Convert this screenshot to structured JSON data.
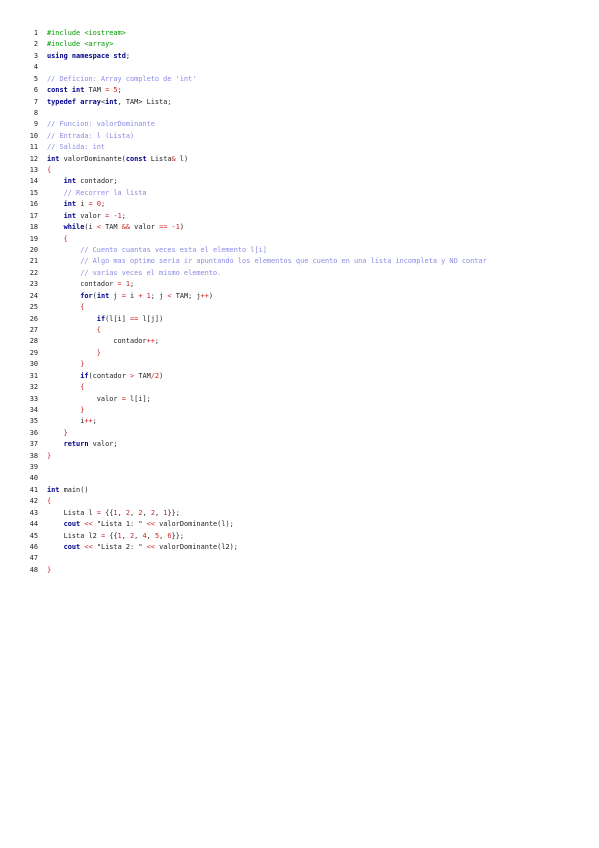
{
  "document": {
    "language": "cpp",
    "lines": [
      [
        {
          "t": "#include <iostream>",
          "c": "pp"
        }
      ],
      [
        {
          "t": "#include <array>",
          "c": "pp"
        }
      ],
      [
        {
          "t": "using",
          "c": "kw"
        },
        {
          "t": " "
        },
        {
          "t": "namespace",
          "c": "kw"
        },
        {
          "t": " "
        },
        {
          "t": "std",
          "c": "kw"
        },
        {
          "t": ";"
        }
      ],
      [],
      [
        {
          "t": "// Deficion: Array completo de 'int'",
          "c": "cm"
        }
      ],
      [
        {
          "t": "const",
          "c": "kw"
        },
        {
          "t": " "
        },
        {
          "t": "int",
          "c": "ty"
        },
        {
          "t": " TAM "
        },
        {
          "t": "=",
          "c": "op"
        },
        {
          "t": " "
        },
        {
          "t": "5",
          "c": "num"
        },
        {
          "t": ";"
        }
      ],
      [
        {
          "t": "typedef",
          "c": "kw"
        },
        {
          "t": " "
        },
        {
          "t": "array",
          "c": "kw"
        },
        {
          "t": "<"
        },
        {
          "t": "int",
          "c": "ty"
        },
        {
          "t": ", TAM> Lista;"
        }
      ],
      [],
      [
        {
          "t": "// Funcion: valorDominante",
          "c": "cm"
        }
      ],
      [
        {
          "t": "// Entrada: l (Lista)",
          "c": "cm"
        }
      ],
      [
        {
          "t": "// Salida: int",
          "c": "cm"
        }
      ],
      [
        {
          "t": "int",
          "c": "ty"
        },
        {
          "t": " valorDominante("
        },
        {
          "t": "const",
          "c": "kw"
        },
        {
          "t": " Lista"
        },
        {
          "t": "&",
          "c": "op"
        },
        {
          "t": " l)"
        }
      ],
      [
        {
          "t": "{",
          "c": "br"
        }
      ],
      [
        {
          "t": "    "
        },
        {
          "t": "int",
          "c": "ty"
        },
        {
          "t": " contador;"
        }
      ],
      [
        {
          "t": "    "
        },
        {
          "t": "// Recorrer la lista",
          "c": "cm"
        }
      ],
      [
        {
          "t": "    "
        },
        {
          "t": "int",
          "c": "ty"
        },
        {
          "t": " i "
        },
        {
          "t": "=",
          "c": "op"
        },
        {
          "t": " "
        },
        {
          "t": "0",
          "c": "num"
        },
        {
          "t": ";"
        }
      ],
      [
        {
          "t": "    "
        },
        {
          "t": "int",
          "c": "ty"
        },
        {
          "t": " valor "
        },
        {
          "t": "=",
          "c": "op"
        },
        {
          "t": " "
        },
        {
          "t": "-1",
          "c": "num"
        },
        {
          "t": ";"
        }
      ],
      [
        {
          "t": "    "
        },
        {
          "t": "while",
          "c": "kw"
        },
        {
          "t": "(i "
        },
        {
          "t": "<",
          "c": "op"
        },
        {
          "t": " TAM "
        },
        {
          "t": "&&",
          "c": "op"
        },
        {
          "t": " valor "
        },
        {
          "t": "==",
          "c": "op"
        },
        {
          "t": " "
        },
        {
          "t": "-1",
          "c": "num"
        },
        {
          "t": ")"
        }
      ],
      [
        {
          "t": "    "
        },
        {
          "t": "{",
          "c": "br"
        }
      ],
      [
        {
          "t": "        "
        },
        {
          "t": "// Cuento cuantas veces esta el elemento l[i]",
          "c": "cm"
        }
      ],
      [
        {
          "t": "        "
        },
        {
          "t": "// Algo mas optimo seria ir apuntando los elementos que cuento en una lista incompleta y NO contar",
          "c": "cm"
        }
      ],
      [
        {
          "t": "        "
        },
        {
          "t": "// varias veces el mismo elemento.",
          "c": "cm"
        }
      ],
      [
        {
          "t": "        contador "
        },
        {
          "t": "=",
          "c": "op"
        },
        {
          "t": " "
        },
        {
          "t": "1",
          "c": "num"
        },
        {
          "t": ";"
        }
      ],
      [
        {
          "t": "        "
        },
        {
          "t": "for",
          "c": "kw"
        },
        {
          "t": "("
        },
        {
          "t": "int",
          "c": "ty"
        },
        {
          "t": " j "
        },
        {
          "t": "=",
          "c": "op"
        },
        {
          "t": " i "
        },
        {
          "t": "+",
          "c": "op"
        },
        {
          "t": " "
        },
        {
          "t": "1",
          "c": "num"
        },
        {
          "t": "; j "
        },
        {
          "t": "<",
          "c": "op"
        },
        {
          "t": " TAM; j"
        },
        {
          "t": "++",
          "c": "op"
        },
        {
          "t": ")"
        }
      ],
      [
        {
          "t": "        "
        },
        {
          "t": "{",
          "c": "br"
        }
      ],
      [
        {
          "t": "            "
        },
        {
          "t": "if",
          "c": "kw"
        },
        {
          "t": "(l[i] "
        },
        {
          "t": "==",
          "c": "op"
        },
        {
          "t": " l[j])"
        }
      ],
      [
        {
          "t": "            "
        },
        {
          "t": "{",
          "c": "br"
        }
      ],
      [
        {
          "t": "                contador"
        },
        {
          "t": "++",
          "c": "op"
        },
        {
          "t": ";"
        }
      ],
      [
        {
          "t": "            "
        },
        {
          "t": "}",
          "c": "br"
        }
      ],
      [
        {
          "t": "        "
        },
        {
          "t": "}",
          "c": "br"
        }
      ],
      [
        {
          "t": "        "
        },
        {
          "t": "if",
          "c": "kw"
        },
        {
          "t": "(contador "
        },
        {
          "t": ">",
          "c": "op"
        },
        {
          "t": " TAM"
        },
        {
          "t": "/",
          "c": "op"
        },
        {
          "t": "2",
          "c": "num"
        },
        {
          "t": ")"
        }
      ],
      [
        {
          "t": "        "
        },
        {
          "t": "{",
          "c": "br"
        }
      ],
      [
        {
          "t": "            valor "
        },
        {
          "t": "=",
          "c": "op"
        },
        {
          "t": " l[i];"
        }
      ],
      [
        {
          "t": "        "
        },
        {
          "t": "}",
          "c": "br"
        }
      ],
      [
        {
          "t": "        i"
        },
        {
          "t": "++",
          "c": "op"
        },
        {
          "t": ";"
        }
      ],
      [
        {
          "t": "    "
        },
        {
          "t": "}",
          "c": "br"
        }
      ],
      [
        {
          "t": "    "
        },
        {
          "t": "return",
          "c": "kw"
        },
        {
          "t": " valor;"
        }
      ],
      [
        {
          "t": "}",
          "c": "br"
        }
      ],
      [],
      [],
      [
        {
          "t": "int",
          "c": "ty"
        },
        {
          "t": " main()"
        }
      ],
      [
        {
          "t": "{",
          "c": "br"
        }
      ],
      [
        {
          "t": "    Lista l "
        },
        {
          "t": "=",
          "c": "op"
        },
        {
          "t": " {{"
        },
        {
          "t": "1",
          "c": "num"
        },
        {
          "t": ", "
        },
        {
          "t": "2",
          "c": "num"
        },
        {
          "t": ", "
        },
        {
          "t": "2",
          "c": "num"
        },
        {
          "t": ", "
        },
        {
          "t": "2",
          "c": "num"
        },
        {
          "t": ", "
        },
        {
          "t": "1",
          "c": "num"
        },
        {
          "t": "}};"
        }
      ],
      [
        {
          "t": "    "
        },
        {
          "t": "cout",
          "c": "kw"
        },
        {
          "t": " "
        },
        {
          "t": "<<",
          "c": "op"
        },
        {
          "t": " \"Lista 1: \" ",
          "c": "str"
        },
        {
          "t": "<<",
          "c": "op"
        },
        {
          "t": " valorDominante(l);"
        }
      ],
      [
        {
          "t": "    Lista l2 "
        },
        {
          "t": "=",
          "c": "op"
        },
        {
          "t": " {{"
        },
        {
          "t": "1",
          "c": "num"
        },
        {
          "t": ", "
        },
        {
          "t": "2",
          "c": "num"
        },
        {
          "t": ", "
        },
        {
          "t": "4",
          "c": "num"
        },
        {
          "t": ", "
        },
        {
          "t": "5",
          "c": "num"
        },
        {
          "t": ", "
        },
        {
          "t": "6",
          "c": "num"
        },
        {
          "t": "}};"
        }
      ],
      [
        {
          "t": "    "
        },
        {
          "t": "cout",
          "c": "kw"
        },
        {
          "t": " "
        },
        {
          "t": "<<",
          "c": "op"
        },
        {
          "t": " \"Lista 2: \" ",
          "c": "str"
        },
        {
          "t": "<<",
          "c": "op"
        },
        {
          "t": " valorDominante(l2);"
        }
      ],
      [],
      [
        {
          "t": "}",
          "c": "br"
        }
      ]
    ]
  }
}
